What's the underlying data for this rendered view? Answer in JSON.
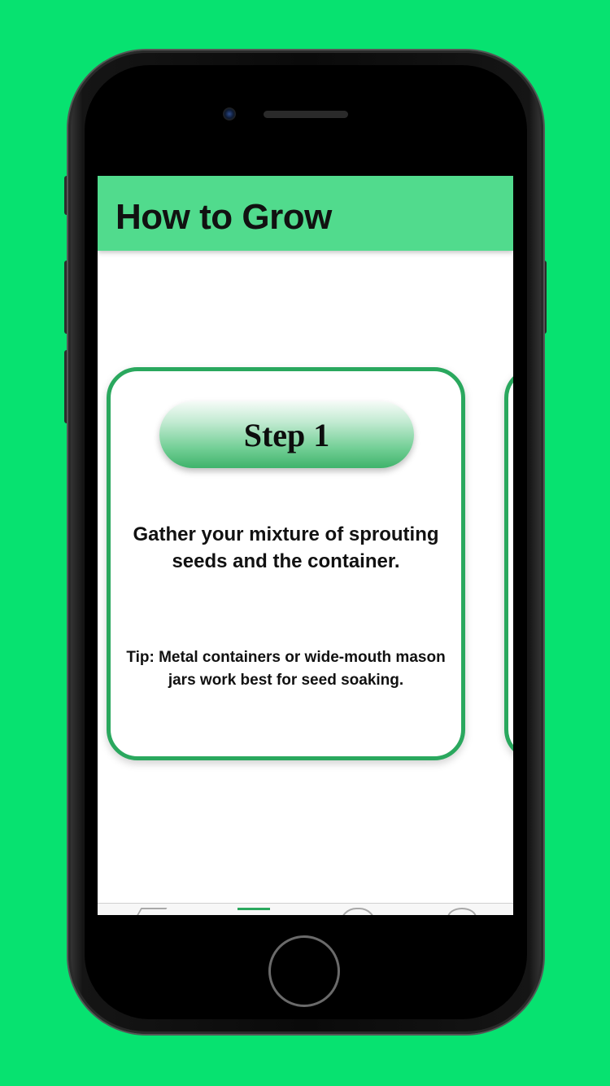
{
  "background_color": "#07e270",
  "header": {
    "title": "How to Grow",
    "color": "#51db8d"
  },
  "card": {
    "step_label": "Step 1",
    "instruction": "Gather your mixture of sprouting seeds and the container.",
    "tip": "Tip: Metal containers or wide-mouth mason jars work best for seed soaking.",
    "border_color": "#2aa85e"
  },
  "tabbar": {
    "items": [
      {
        "icon": "home-icon",
        "active": false
      },
      {
        "icon": "list-icon",
        "active": true
      },
      {
        "icon": "heart-icon",
        "active": false
      },
      {
        "icon": "person-icon",
        "active": false
      }
    ],
    "active_color": "#2aa85e"
  }
}
